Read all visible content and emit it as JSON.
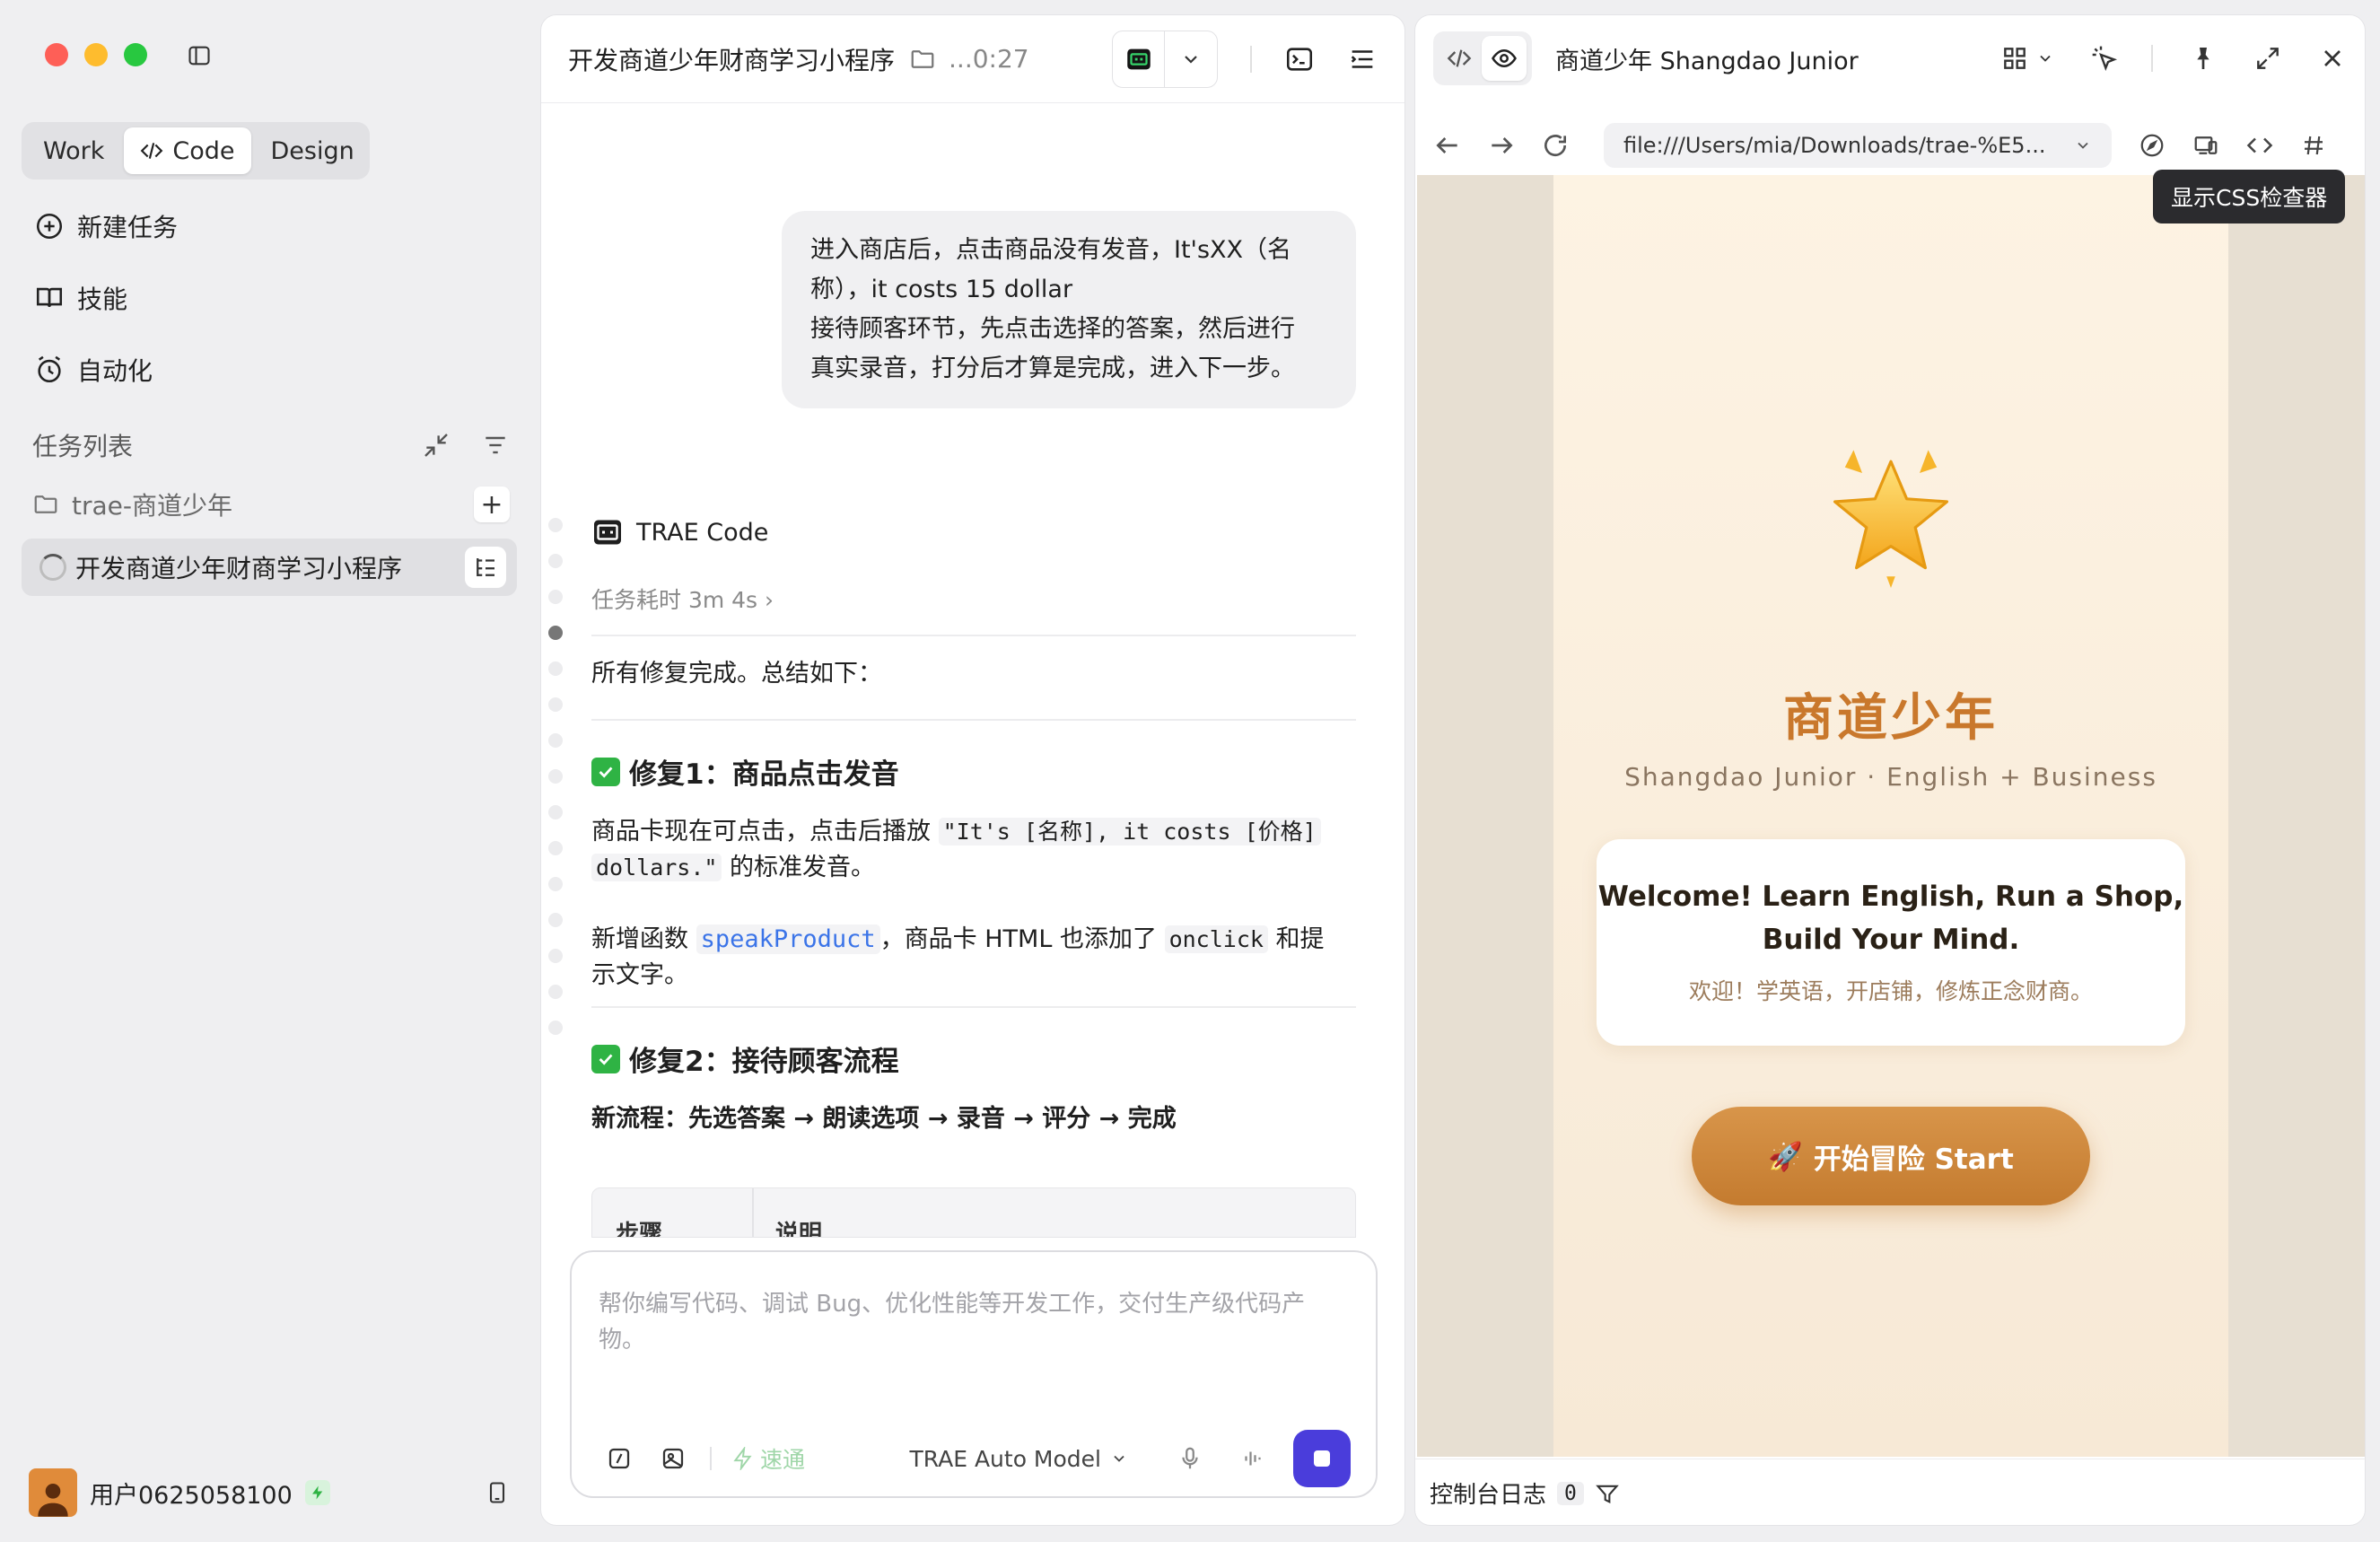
{
  "sidebar": {
    "mode_tabs": [
      {
        "label": "Work",
        "active": false
      },
      {
        "label": "Code",
        "active": true
      },
      {
        "label": "Design",
        "active": false
      }
    ],
    "nav": {
      "new_task": "新建任务",
      "skills": "技能",
      "automation": "自动化"
    },
    "task_list_title": "任务列表",
    "project_folder": "trae-商道少年",
    "active_task": "开发商道少年财商学习小程序",
    "user_name": "用户0625058100"
  },
  "chat": {
    "title": "开发商道少年财商学习小程序",
    "elapsed": "...0:27",
    "user_message_lines": [
      "进入商店后，点击商品没有发音，It'sXX（名",
      "称），it costs 15 dollar",
      "接待顾客环节，先点击选择的答案，然后进行",
      "真实录音，打分后才算是完成，进入下一步。"
    ],
    "agent_name": "TRAE Code",
    "duration": "任务耗时 3m 4s",
    "summary": "所有修复完成。总结如下：",
    "fix1": {
      "heading": "修复1：商品点击发音",
      "p1_pre": "商品卡现在可点击，点击后播放 ",
      "p1_code1": "\"It's [名称], it costs [价格]",
      "p1_code2": "dollars.\"",
      "p1_post": " 的标准发音。",
      "p2_pre": "新增函数 ",
      "p2_fn": "speakProduct",
      "p2_mid": "，商品卡 HTML 也添加了 ",
      "p2_attr": "onclick",
      "p2_post": " 和提",
      "p2_line2": "示文字。"
    },
    "fix2": {
      "heading": "修复2：接待顾客流程",
      "flow": "新流程：先选答案 → 朗读选项 → 录音 → 评分 → 完成"
    },
    "table_headers": [
      "步骤",
      "说明"
    ],
    "composer": {
      "placeholder": "帮你编写代码、调试 Bug、优化性能等开发工作，交付生产级代码产物。",
      "speed_label": "速通",
      "model_label": "TRAE Auto Model"
    }
  },
  "preview": {
    "title": "商道少年 Shangdao Junior",
    "url": "file:///Users/mia/Downloads/trae-%E5...",
    "tooltip": "显示CSS检查器",
    "app": {
      "title": "商道少年",
      "subtitle": "Shangdao Junior · English + Business",
      "welcome_line1": "Welcome! Learn English, Run a Shop,",
      "welcome_line2": "Build Your Mind.",
      "welcome_cn": "欢迎！学英语，开店铺，修炼正念财商。",
      "start_label": "开始冒险 Start",
      "start_emoji": "🚀"
    },
    "console_label": "控制台日志",
    "console_count": "0"
  },
  "colors": {
    "accent": "#4a3ddb",
    "brand_orange": "#c9782c",
    "success": "#2fb344",
    "link": "#3b74e8"
  },
  "icons": [
    "sidebar-toggle-icon",
    "code-icon",
    "new-task-icon",
    "skills-icon",
    "clock-icon",
    "collapse-icon",
    "filter-icon",
    "folder-icon",
    "spinner-icon",
    "task-list-icon",
    "bolt-icon",
    "phone-icon",
    "terminal-icon",
    "chevron-down-icon",
    "outline-icon",
    "eye-icon",
    "grid-icon",
    "pointer-icon",
    "pin-icon",
    "expand-icon",
    "close-icon",
    "back-icon",
    "forward-icon",
    "reload-icon",
    "compass-icon",
    "device-icon",
    "hash-icon",
    "star-icon",
    "rocket-icon",
    "funnel-icon"
  ]
}
